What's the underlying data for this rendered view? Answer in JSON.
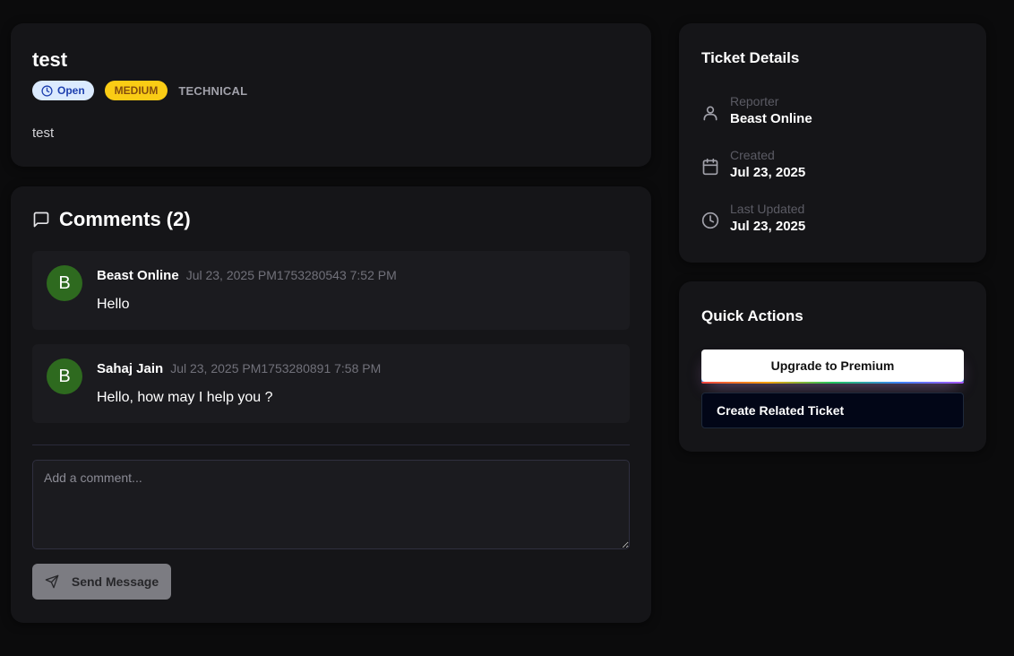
{
  "ticket": {
    "title": "test",
    "status": "Open",
    "priority": "MEDIUM",
    "category": "TECHNICAL",
    "description": "test"
  },
  "comments": {
    "title": "Comments (2)",
    "items": [
      {
        "avatar_initial": "B",
        "author": "Beast Online",
        "timestamp": "Jul 23, 2025 PM1753280543 7:52 PM",
        "body": "Hello"
      },
      {
        "avatar_initial": "B",
        "author": "Sahaj Jain",
        "timestamp": "Jul 23, 2025 PM1753280891 7:58 PM",
        "body": "Hello, how may I help you ?"
      }
    ],
    "input_placeholder": "Add a comment...",
    "input_value": "",
    "send_label": "Send Message"
  },
  "details": {
    "title": "Ticket Details",
    "reporter_label": "Reporter",
    "reporter_value": "Beast Online",
    "created_label": "Created",
    "created_value": "Jul 23, 2025",
    "updated_label": "Last Updated",
    "updated_value": "Jul 23, 2025"
  },
  "actions": {
    "title": "Quick Actions",
    "premium_label": "Upgrade to Premium",
    "related_label": "Create Related Ticket"
  },
  "icons": {
    "status": "clock-icon",
    "comments": "message-square-icon",
    "reporter": "user-icon",
    "created": "calendar-icon",
    "updated": "clock-icon",
    "send": "send-icon"
  },
  "colors": {
    "status_badge_bg": "#dbeafe",
    "priority_badge_bg": "#facc15",
    "avatar_bg": "#2e6a1f"
  }
}
